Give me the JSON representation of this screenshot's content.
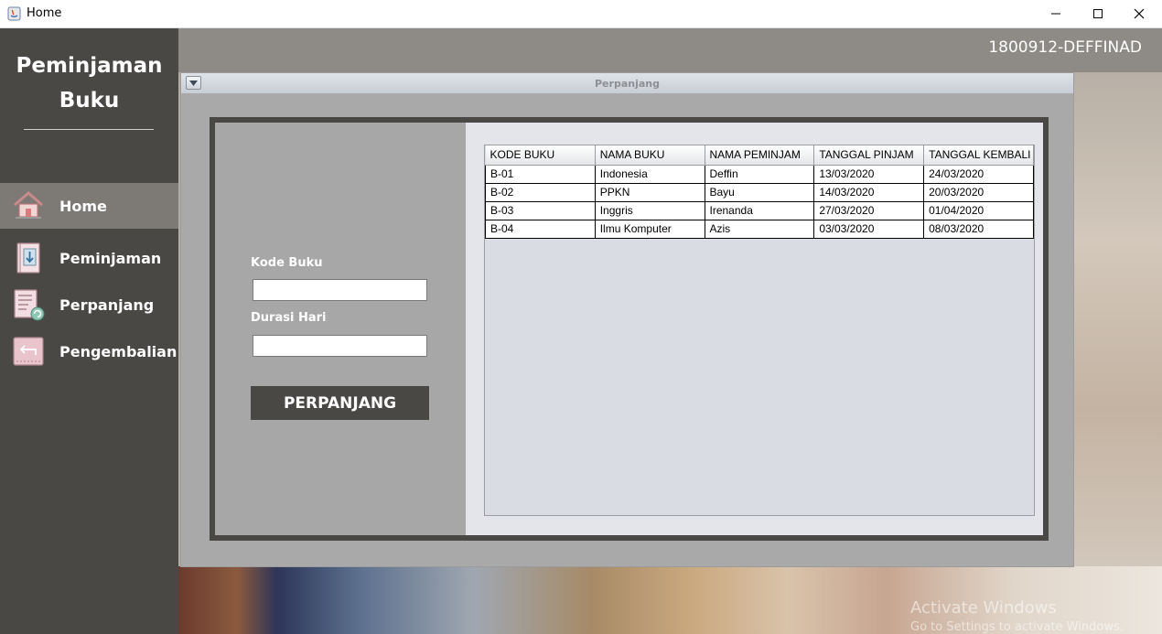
{
  "window": {
    "title": "Home",
    "app_icon": "java-icon",
    "controls": [
      "minimize-icon",
      "maximize-icon",
      "close-icon"
    ]
  },
  "sidebar": {
    "brand_line1": "Peminjaman",
    "brand_line2": "Buku",
    "items": [
      {
        "label": "Home",
        "icon": "house-icon",
        "active": true
      },
      {
        "label": "Peminjaman",
        "icon": "download-book-icon"
      },
      {
        "label": "Perpanjang",
        "icon": "renew-document-icon"
      },
      {
        "label": "Pengembalian",
        "icon": "return-arrow-icon"
      }
    ]
  },
  "header": {
    "user": "1800912-DEFFINAD"
  },
  "internal_frame": {
    "title": "Perpanjang"
  },
  "form": {
    "kode_label": "Kode Buku",
    "kode_value": "",
    "durasi_label": "Durasi Hari",
    "durasi_value": "",
    "button_label": "PERPANJANG"
  },
  "table": {
    "columns": [
      "KODE BUKU",
      "NAMA BUKU",
      "NAMA PEMINJAM",
      "TANGGAL PINJAM",
      "TANGGAL KEMBALI"
    ],
    "rows": [
      [
        "B-01",
        "Indonesia",
        "Deffin",
        "13/03/2020",
        "24/03/2020"
      ],
      [
        "B-02",
        "PPKN",
        "Bayu",
        "14/03/2020",
        "20/03/2020"
      ],
      [
        "B-03",
        "Inggris",
        "Irenanda",
        "27/03/2020",
        "01/04/2020"
      ],
      [
        "B-04",
        "Ilmu Komputer",
        "Azis",
        "03/03/2020",
        "08/03/2020"
      ]
    ]
  },
  "watermark": {
    "line1": "Activate Windows",
    "line2": "Go to Settings to activate Windows."
  },
  "colors": {
    "sidebar": "#4a4845",
    "sidebar_active": "#7d7a76",
    "panel_dark": "#4a4845",
    "panel_left": "#a7a7a7",
    "panel_right": "#e3e5ea"
  }
}
